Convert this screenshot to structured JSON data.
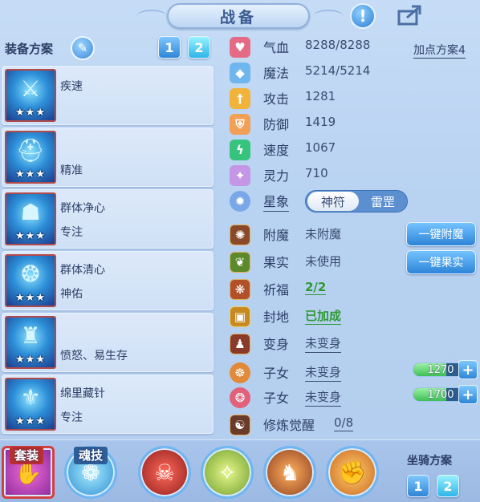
{
  "header": {
    "title": "战备",
    "warning_icon": "exclamation-icon",
    "share_icon": "share-icon"
  },
  "equip_plan": {
    "title": "装备方案",
    "plans": [
      "1",
      "2"
    ],
    "active_plan": "2"
  },
  "equipment": [
    {
      "line1": "疾速",
      "line2": "",
      "stars": "★★★",
      "glyph": "⚔"
    },
    {
      "line1": "",
      "line2": "精准",
      "stars": "★★★",
      "glyph": "⛑"
    },
    {
      "line1": "群体净心",
      "line2": "专注",
      "stars": "★★★",
      "glyph": "☗"
    },
    {
      "line1": "群体清心",
      "line2": "神佑",
      "stars": "★★★",
      "glyph": "❂"
    },
    {
      "line1": "",
      "line2": "愤怒、易生存",
      "stars": "★★★",
      "glyph": "♜"
    },
    {
      "line1": "绵里藏针",
      "line2": "专注",
      "stars": "★★★",
      "glyph": "⚜"
    }
  ],
  "stats": {
    "add_plan": "加点方案4",
    "hp": {
      "label": "气血",
      "value": "8288/8288"
    },
    "mp": {
      "label": "魔法",
      "value": "5214/5214"
    },
    "atk": {
      "label": "攻击",
      "value": "1281"
    },
    "def": {
      "label": "防御",
      "value": "1419"
    },
    "spd": {
      "label": "速度",
      "value": "1067"
    },
    "spi": {
      "label": "灵力",
      "value": "710"
    },
    "star": {
      "label": "星象",
      "toggle_on": "神符",
      "toggle_off": "雷罡"
    }
  },
  "extras": {
    "enchant": {
      "label": "附魔",
      "value": "未附魔",
      "button": "一键附魔"
    },
    "fruit": {
      "label": "果实",
      "value": "未使用",
      "button": "一键果实"
    },
    "bless": {
      "label": "祈福",
      "value": "2/2"
    },
    "fengdi": {
      "label": "封地",
      "value": "已加成"
    },
    "transform": {
      "label": "变身",
      "value": "未变身"
    },
    "child1": {
      "label": "子女",
      "value": "未变身",
      "bar": "1270",
      "fill": 0.6
    },
    "child2": {
      "label": "子女",
      "value": "未变身",
      "bar": "1700",
      "fill": 0.6
    },
    "awaken": {
      "label": "修炼觉醒",
      "value": "0/8"
    }
  },
  "bottom": {
    "suit_label": "套装",
    "soul_label": "魂技",
    "mount_title": "坐骑方案",
    "mount_plans": [
      "1",
      "2"
    ]
  },
  "colors": {
    "accent": "#2f86d6",
    "green": "#2f9a35",
    "panel": "#b8d2f1"
  }
}
